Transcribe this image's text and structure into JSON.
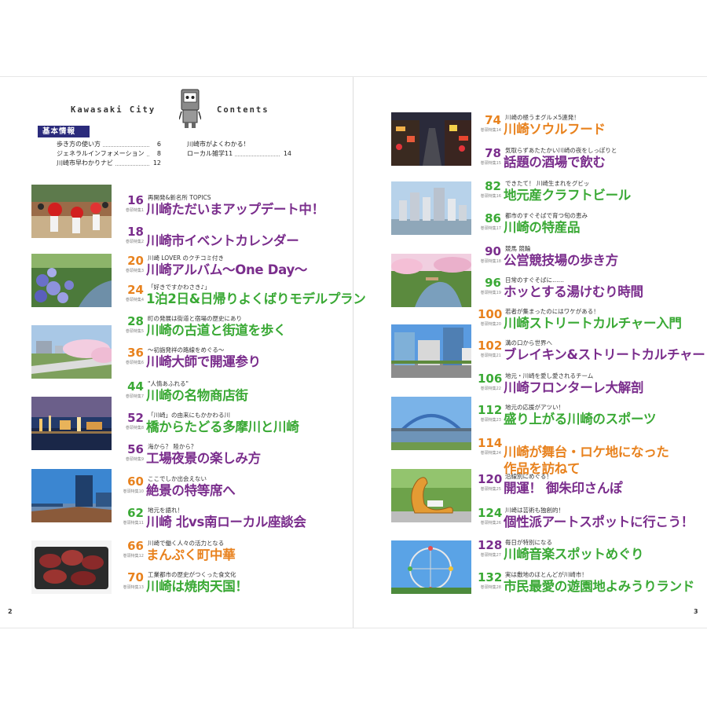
{
  "header": {
    "city": "Kawasaki City",
    "contents": "Contents"
  },
  "basic_info": {
    "label": "基本情報",
    "left": [
      {
        "label": "歩き方の使い方",
        "page": "6"
      },
      {
        "label": "ジェネラルインフォメーション",
        "page": "8"
      },
      {
        "label": "川崎市早わかりナビ",
        "page": "12"
      }
    ],
    "right": [
      {
        "label": "川崎市がよくわかる！",
        "page": ""
      },
      {
        "label": "ローカル雑学11",
        "page": "14"
      }
    ]
  },
  "left_entries": [
    {
      "page": "16",
      "tag": "巻頭特集1",
      "kicker": "再開発&新名所 TOPICS",
      "title": "川崎ただいまアップデート中！"
    },
    {
      "page": "18",
      "tag": "巻頭特集2",
      "kicker": "",
      "title": "川崎市イベントカレンダー"
    },
    {
      "page": "20",
      "tag": "巻頭特集3",
      "kicker": "川崎 LOVER のクチコミ付き",
      "title": "川崎アルバム〜One Day〜"
    },
    {
      "page": "24",
      "tag": "巻頭特集4",
      "kicker": "「好きですかわさき♪」",
      "title": "1泊2日&日帰りよくばりモデルプラン"
    },
    {
      "page": "28",
      "tag": "巻頭特集5",
      "kicker": "町の発展は街道と宿場の歴史にあり",
      "title": "川崎の古道と街道を歩く"
    },
    {
      "page": "36",
      "tag": "巻頭特集6",
      "kicker": "〜初詣発祥の路線をめぐる〜",
      "title": "川崎大師で開運参り"
    },
    {
      "page": "44",
      "tag": "巻頭特集7",
      "kicker": "\"人情あふれる\"",
      "title": "川崎の名物商店街"
    },
    {
      "page": "52",
      "tag": "巻頭特集8",
      "kicker": "「川崎」の由来にもかかわる川",
      "title": "橋からたどる多摩川と川崎"
    },
    {
      "page": "56",
      "tag": "巻頭特集9",
      "kicker": "海から？ 陸から？",
      "title": "工場夜景の楽しみ方"
    },
    {
      "page": "60",
      "tag": "巻頭特集10",
      "kicker": "ここでしか出会えない",
      "title": "絶景の特等席へ"
    },
    {
      "page": "62",
      "tag": "巻頭特集11",
      "kicker": "地元を語れ！",
      "title": "川崎 北vs南ローカル座談会"
    },
    {
      "page": "66",
      "tag": "巻頭特集12",
      "kicker": "川崎で働く人々の活力となる",
      "title": "まんぷく町中華"
    },
    {
      "page": "70",
      "tag": "巻頭特集13",
      "kicker": "工業都市の歴史がつくった食文化",
      "title": "川崎は焼肉天国！"
    }
  ],
  "right_entries": [
    {
      "page": "74",
      "tag": "巻頭特集14",
      "kicker": "川崎の極うまグルメ5連発！",
      "title": "川崎ソウルフード",
      "title2": ""
    },
    {
      "page": "78",
      "tag": "巻頭特集15",
      "kicker": "気取らずあたたかい川崎の夜をしっぽりと",
      "title": "話題の酒場で飲む",
      "title2": ""
    },
    {
      "page": "82",
      "tag": "巻頭特集16",
      "kicker": "できたて！ 川崎生まれをグビッ",
      "title": "地元産クラフトビール",
      "title2": ""
    },
    {
      "page": "86",
      "tag": "巻頭特集17",
      "kicker": "都市のすぐそばで育つ旬の恵み",
      "title": "川崎の特産品",
      "title2": ""
    },
    {
      "page": "90",
      "tag": "巻頭特集18",
      "kicker": "競馬 競輪",
      "title": "公営競技場の歩き方",
      "title2": ""
    },
    {
      "page": "96",
      "tag": "巻頭特集19",
      "kicker": "日常のすぐそばに……",
      "title": "ホッとする湯けむり時間",
      "title2": ""
    },
    {
      "page": "100",
      "tag": "巻頭特集20",
      "kicker": "若者が集まったのにはワケがある！",
      "title": "川崎ストリートカルチャー入門",
      "title2": ""
    },
    {
      "page": "102",
      "tag": "巻頭特集21",
      "kicker": "溝の口から世界へ",
      "title": "ブレイキン&ストリートカルチャー",
      "title2": ""
    },
    {
      "page": "106",
      "tag": "巻頭特集22",
      "kicker": "地元・川崎を愛し愛されるチーム",
      "title": "川崎フロンターレ大解剖",
      "title2": ""
    },
    {
      "page": "112",
      "tag": "巻頭特集23",
      "kicker": "地元の応援がアツい！",
      "title": "盛り上がる川崎のスポーツ",
      "title2": ""
    },
    {
      "page": "114",
      "tag": "巻頭特集24",
      "kicker": "",
      "title": "川崎が舞台・ロケ地になった",
      "title2": "作品を訪ねて"
    },
    {
      "page": "120",
      "tag": "巻頭特集25",
      "kicker": "沿線別にめぐる！",
      "title": "開運！ 御朱印さんぽ",
      "title2": ""
    },
    {
      "page": "124",
      "tag": "巻頭特集26",
      "kicker": "川崎は芸術も独創的！",
      "title": "個性派アートスポットに行こう！",
      "title2": ""
    },
    {
      "page": "128",
      "tag": "巻頭特集27",
      "kicker": "毎日が特別になる",
      "title": "川崎音楽スポットめぐり",
      "title2": ""
    },
    {
      "page": "132",
      "tag": "巻頭特集28",
      "kicker": "実は敷地のほとんどが川崎市！",
      "title": "市民最愛の遊園地よみうりランド",
      "title2": ""
    }
  ],
  "photos": {
    "left": [
      "festival-photo",
      "hydrangea-photo",
      "cherry-river-photo",
      "factory-night-photo",
      "tower-park-photo",
      "yakiniku-photo"
    ],
    "right": [
      "izakaya-alley-photo",
      "city-skyline-photo",
      "stream-garden-photo",
      "station-plaza-photo",
      "arch-bridge-photo",
      "swan-sculpture-photo",
      "ferris-wheel-photo"
    ]
  },
  "colors": {
    "green": "#3aa935",
    "purple": "#7a2d8c",
    "orange": "#e8821e",
    "navy": "#2b2b7c"
  },
  "folios": {
    "left": "2",
    "right": "3"
  }
}
